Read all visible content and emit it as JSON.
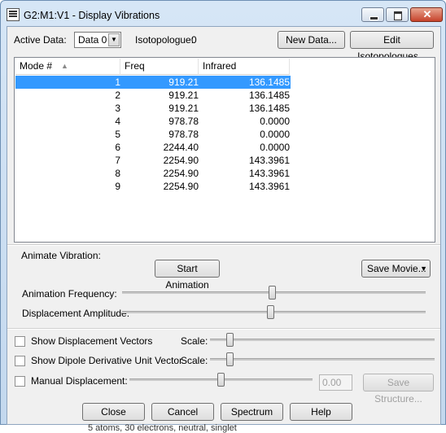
{
  "window": {
    "title": "G2:M1:V1 - Display Vibrations"
  },
  "top": {
    "active_data_label": "Active Data:",
    "active_data_value": "Data 0",
    "isotopologue_label": "Isotopologue:",
    "isotopologue_value": "0",
    "new_data_button": "New Data...",
    "edit_isotopologues_button": "Edit Isotopologues..."
  },
  "table": {
    "columns": [
      "Mode #",
      "Freq",
      "Infrared"
    ],
    "rows": [
      {
        "mode": "1",
        "freq": "919.21",
        "infrared": "136.1485",
        "selected": true
      },
      {
        "mode": "2",
        "freq": "919.21",
        "infrared": "136.1485"
      },
      {
        "mode": "3",
        "freq": "919.21",
        "infrared": "136.1485"
      },
      {
        "mode": "4",
        "freq": "978.78",
        "infrared": "0.0000"
      },
      {
        "mode": "5",
        "freq": "978.78",
        "infrared": "0.0000"
      },
      {
        "mode": "6",
        "freq": "2244.40",
        "infrared": "0.0000"
      },
      {
        "mode": "7",
        "freq": "2254.90",
        "infrared": "143.3961"
      },
      {
        "mode": "8",
        "freq": "2254.90",
        "infrared": "143.3961"
      },
      {
        "mode": "9",
        "freq": "2254.90",
        "infrared": "143.3961"
      }
    ]
  },
  "animate": {
    "section_label": "Animate Vibration:",
    "start_button": "Start Animation",
    "save_movie_button": "Save Movie...",
    "frequency_label": "Animation Frequency:",
    "amplitude_label": "Displacement Amplitude:"
  },
  "options": {
    "show_displacement_vectors": "Show Displacement Vectors",
    "show_dipole_vector": "Show Dipole Derivative Unit Vector",
    "scale_label": "Scale:",
    "manual_displacement": "Manual Displacement:",
    "manual_value": "0.00",
    "save_structure_button": "Save Structure..."
  },
  "buttons": {
    "close": "Close",
    "cancel": "Cancel",
    "spectrum": "Spectrum",
    "help": "Help"
  },
  "status_text": "5 atoms, 30 electrons, neutral, singlet"
}
